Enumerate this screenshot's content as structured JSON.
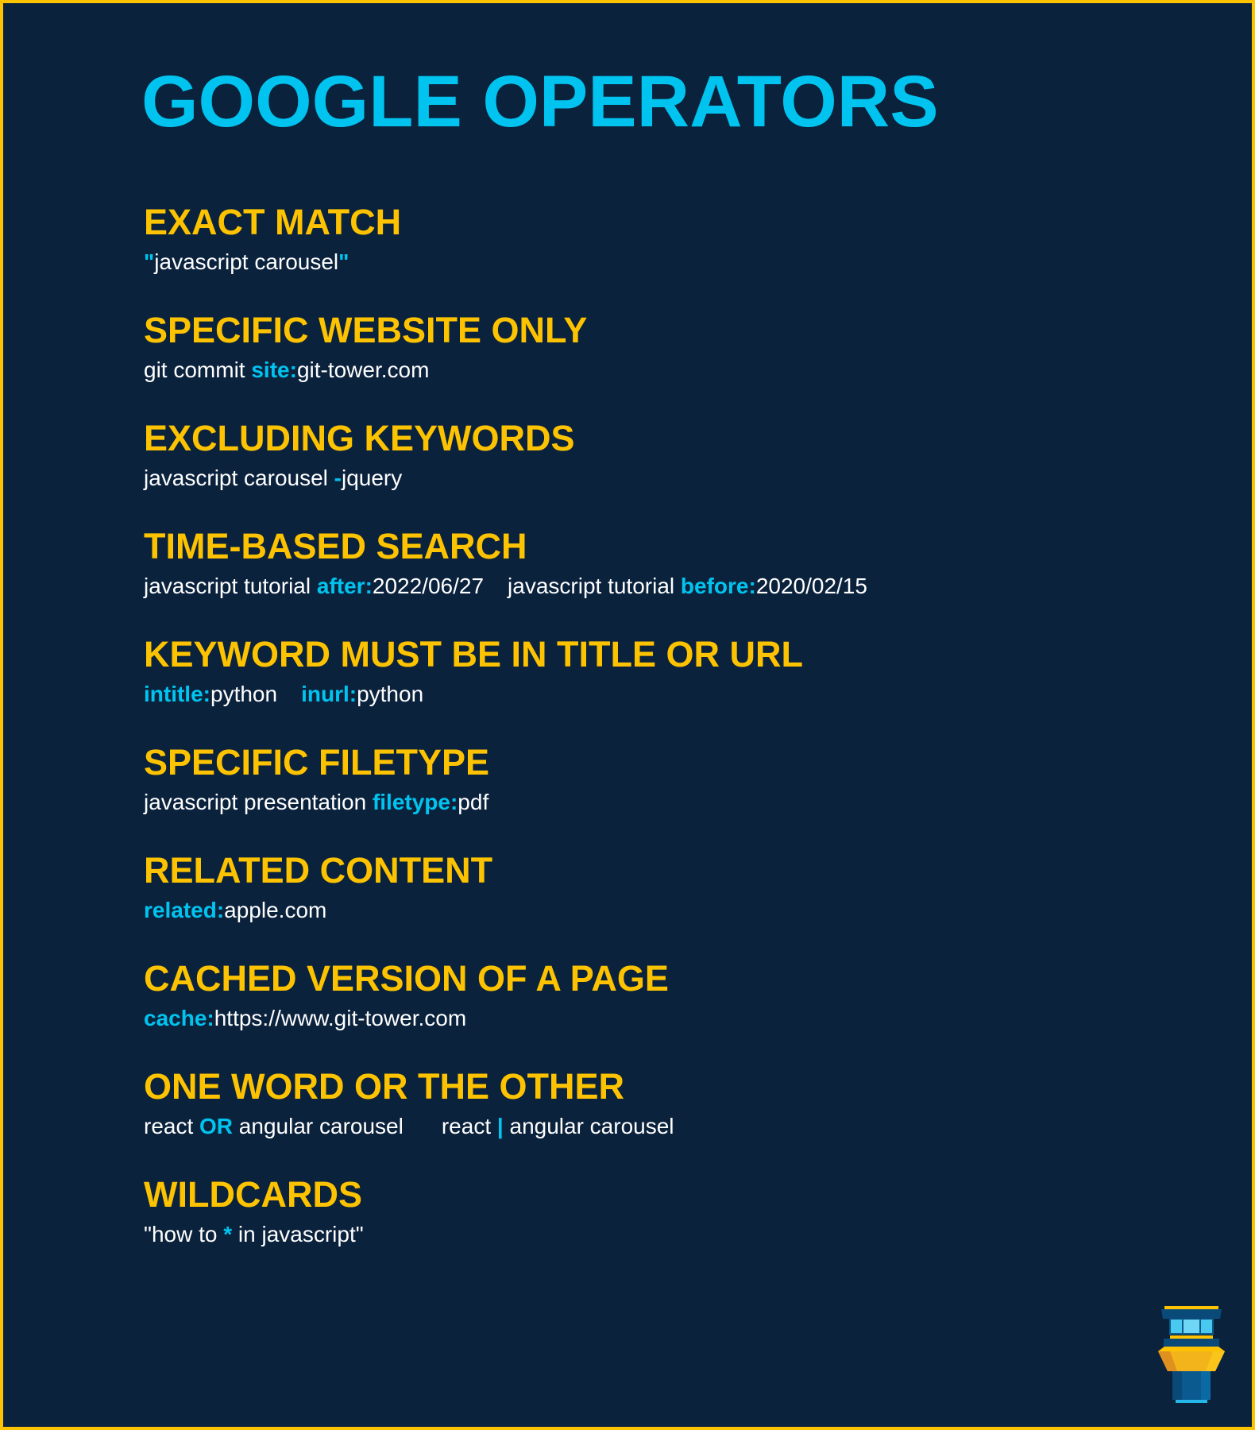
{
  "colors": {
    "background": "#0b223d",
    "border": "#fdc300",
    "title": "#00c4ef",
    "heading": "#fdc300",
    "text": "#ffffff",
    "operator": "#00c4ef"
  },
  "title": "GOOGLE OPERATORS",
  "sections": [
    {
      "heading": "EXACT MATCH",
      "examples": [
        {
          "parts": [
            {
              "text": "\"",
              "op": true
            },
            {
              "text": "javascript carousel",
              "op": false
            },
            {
              "text": "\"",
              "op": true
            }
          ]
        }
      ]
    },
    {
      "heading": "SPECIFIC WEBSITE ONLY",
      "examples": [
        {
          "parts": [
            {
              "text": "git commit ",
              "op": false
            },
            {
              "text": "site:",
              "op": true
            },
            {
              "text": "git-tower.com",
              "op": false
            }
          ]
        }
      ]
    },
    {
      "heading": "EXCLUDING KEYWORDS",
      "examples": [
        {
          "parts": [
            {
              "text": "javascript carousel ",
              "op": false
            },
            {
              "text": "-",
              "op": true
            },
            {
              "text": "jquery",
              "op": false
            }
          ]
        }
      ]
    },
    {
      "heading": "TIME-BASED SEARCH",
      "examples": [
        {
          "parts": [
            {
              "text": "javascript tutorial ",
              "op": false
            },
            {
              "text": "after:",
              "op": true
            },
            {
              "text": "2022/06/27",
              "op": false
            }
          ]
        },
        {
          "parts": [
            {
              "text": "javascript tutorial ",
              "op": false
            },
            {
              "text": "before:",
              "op": true
            },
            {
              "text": "2020/02/15",
              "op": false
            }
          ]
        }
      ]
    },
    {
      "heading": "KEYWORD MUST BE IN TITLE OR URL",
      "examples": [
        {
          "parts": [
            {
              "text": "intitle:",
              "op": true
            },
            {
              "text": "python",
              "op": false
            }
          ]
        },
        {
          "parts": [
            {
              "text": "inurl:",
              "op": true
            },
            {
              "text": "python",
              "op": false
            }
          ]
        }
      ]
    },
    {
      "heading": "SPECIFIC FILETYPE",
      "examples": [
        {
          "parts": [
            {
              "text": "javascript presentation ",
              "op": false
            },
            {
              "text": "filetype:",
              "op": true
            },
            {
              "text": "pdf",
              "op": false
            }
          ]
        }
      ]
    },
    {
      "heading": "RELATED CONTENT",
      "examples": [
        {
          "parts": [
            {
              "text": "related:",
              "op": true
            },
            {
              "text": "apple.com",
              "op": false
            }
          ]
        }
      ]
    },
    {
      "heading": "CACHED VERSION OF A PAGE",
      "examples": [
        {
          "parts": [
            {
              "text": "cache:",
              "op": true
            },
            {
              "text": "https://www.git-tower.com",
              "op": false
            }
          ]
        }
      ]
    },
    {
      "heading": "ONE WORD OR THE OTHER",
      "examples": [
        {
          "parts": [
            {
              "text": "react ",
              "op": false
            },
            {
              "text": "OR",
              "op": true
            },
            {
              "text": " angular carousel",
              "op": false
            }
          ]
        },
        {
          "parts": [
            {
              "text": "react ",
              "op": false
            },
            {
              "text": "|",
              "op": true
            },
            {
              "text": " angular carousel",
              "op": false
            }
          ]
        }
      ]
    },
    {
      "heading": "WILDCARDS",
      "examples": [
        {
          "parts": [
            {
              "text": "\"how to ",
              "op": false
            },
            {
              "text": "*",
              "op": true
            },
            {
              "text": " in javascript\"",
              "op": false
            }
          ]
        }
      ]
    }
  ],
  "logo": {
    "icon": "tower-logo-icon"
  }
}
